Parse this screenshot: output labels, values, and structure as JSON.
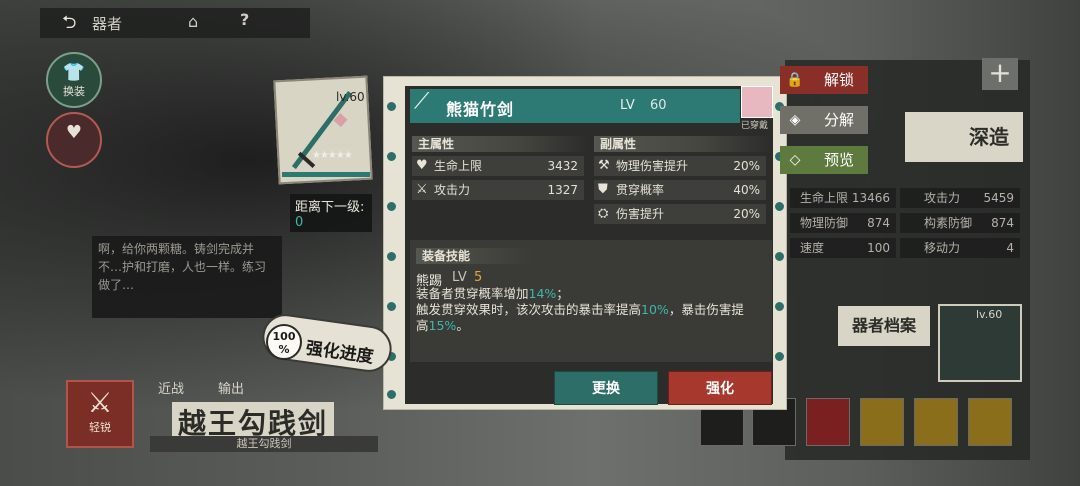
{
  "header": {
    "back_icon": "back-arrow-icon",
    "title": "器者",
    "home_icon": "home-icon",
    "help_icon": "help-icon",
    "help_glyph": "?"
  },
  "left_menu": {
    "outfit_label": "换装",
    "heart_label": ""
  },
  "dialogue": {
    "text": "啊，给你两颗糖。铸剑完成并不…护和打磨，人也一样。练习做了…"
  },
  "weapon_card": {
    "level": "lv.60",
    "stars": "★★★★★"
  },
  "next_level": {
    "label": "距离下一级:",
    "value": "0"
  },
  "enhance_progress": {
    "percent": "100",
    "percent_sign": "%",
    "label": "强化进度"
  },
  "bottom_left": {
    "badge_label": "轻锐",
    "tabs": [
      "近战",
      "输出"
    ],
    "weapon_title": "越王勾践剑",
    "weapon_subtitle": "越王勾践剑"
  },
  "weapon": {
    "name": "熊猫竹剑",
    "lv_label": "LV",
    "lv_value": "60",
    "equipped_label": "已穿戴"
  },
  "main_attr": {
    "title": "主属性",
    "rows": [
      {
        "icon": "heart-icon",
        "name": "生命上限",
        "value": "3432"
      },
      {
        "icon": "crossed-swords-icon",
        "name": "攻击力",
        "value": "1327"
      }
    ]
  },
  "sub_attr": {
    "title": "副属性",
    "rows": [
      {
        "icon": "sword-up-icon",
        "name": "物理伤害提升",
        "value": "20%"
      },
      {
        "icon": "pierce-icon",
        "name": "贯穿概率",
        "value": "40%"
      },
      {
        "icon": "damage-icon",
        "name": "伤害提升",
        "value": "20%"
      }
    ]
  },
  "skill": {
    "title": "装备技能",
    "name": "熊踢",
    "lv_label": "LV",
    "lv_value": "5",
    "line1_a": "装备者贯穿概率增加",
    "line1_hl": "14%",
    "line1_b": "；",
    "line2_a": "触发贯穿效果时，该次攻击的暴击率提高",
    "line2_hl": "10%",
    "line2_b": "，暴击伤害提",
    "line3_a": "高",
    "line3_hl": "15%",
    "line3_b": "。"
  },
  "buttons": {
    "change": "更换",
    "enhance": "强化"
  },
  "side_tabs": [
    {
      "icon": "lock-icon",
      "label": "解锁"
    },
    {
      "icon": "decompose-icon",
      "label": "分解"
    },
    {
      "icon": "preview-icon",
      "label": "预览"
    }
  ],
  "right_bg": {
    "deep_forge": "深造",
    "stats": [
      {
        "name": "生命上限",
        "value": "13466"
      },
      {
        "name": "攻击力",
        "value": "5459"
      },
      {
        "name": "物理防御",
        "value": "874"
      },
      {
        "name": "构素防御",
        "value": "874"
      },
      {
        "name": "速度",
        "value": "100"
      },
      {
        "name": "移动力",
        "value": "4"
      }
    ],
    "archive": "器者档案",
    "thumb_level": "lv.60",
    "plus_glyph": "+"
  },
  "colors": {
    "teal": "#2d7a74",
    "red": "#a6382d",
    "highlight": "#3fb5ac",
    "gold": "#e8a23e"
  }
}
